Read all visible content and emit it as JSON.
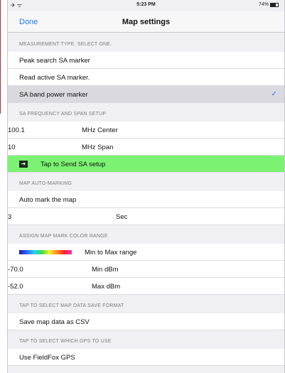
{
  "status": {
    "left_icons": "✈ ᯤ",
    "time": "5:23 PM",
    "battery": "74%"
  },
  "nav": {
    "done": "Done",
    "title": "Map settings"
  },
  "measurement": {
    "header": "MEASUREMENT TYPE. SELECT ONE.",
    "options": [
      "Peak search SA marker",
      "Read active SA marker.",
      "SA band power marker"
    ],
    "selected_index": 2
  },
  "frequency": {
    "header": "SA FREQUENCY AND SPAN SETUP",
    "center_value": "100.1",
    "center_unit": "MHz  Center",
    "span_value": "10",
    "span_unit": "MHz  Span",
    "send_label": "Tap to Send SA setup"
  },
  "automark": {
    "header": "MAP AUTO-MARKING",
    "label": "Auto mark the map",
    "value": "3",
    "unit": "Sec"
  },
  "colorrange": {
    "header": "ASSIGN MAP MARK COLOR RANGE",
    "range_label": "Min to Max range",
    "min_value": "-70.0",
    "min_unit": "Min dBm",
    "max_value": "-52.0",
    "max_unit": "Max dBm"
  },
  "saveformat": {
    "header": "TAP TO SELECT MAP DATA SAVE FORMAT",
    "label": "Save map data as CSV"
  },
  "gps": {
    "header": "TAP TO SELECT WHICH GPS TO USE",
    "label": "Use FieldFox GPS"
  },
  "colors": {
    "accent": "#1a7cf5",
    "send_bg": "#7cf272",
    "selected_bg": "#d9d9df"
  }
}
